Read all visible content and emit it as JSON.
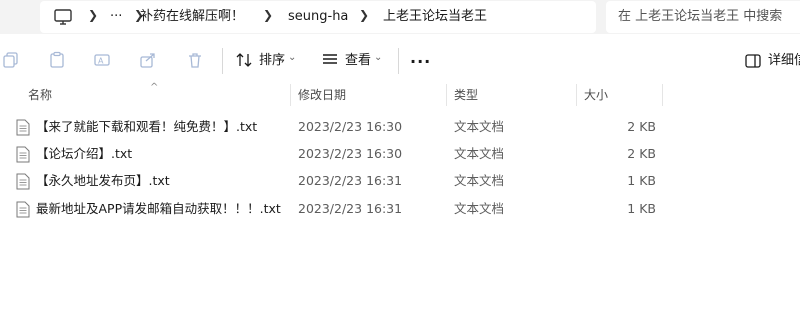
{
  "address": {
    "icon": "computer-icon",
    "breadcrumbs": [
      "补药在线解压啊！",
      "seung-ha",
      "上老王论坛当老王"
    ],
    "overflow": "···"
  },
  "search": {
    "placeholder": "在 上老王论坛当老王 中搜索"
  },
  "toolbar": {
    "sort_label": "排序",
    "view_label": "查看",
    "more_label": "···",
    "details_label": "详细信"
  },
  "columns": {
    "name": "名称",
    "date": "修改日期",
    "type": "类型",
    "size": "大小"
  },
  "files": [
    {
      "name": "【来了就能下载和观看！纯免费！】.txt",
      "date": "2023/2/23 16:30",
      "type": "文本文档",
      "size": "2 KB"
    },
    {
      "name": "【论坛介绍】.txt",
      "date": "2023/2/23 16:30",
      "type": "文本文档",
      "size": "2 KB"
    },
    {
      "name": "【永久地址发布页】.txt",
      "date": "2023/2/23 16:31",
      "type": "文本文档",
      "size": "1 KB"
    },
    {
      "name": "最新地址及APP请发邮箱自动获取！！！.txt",
      "date": "2023/2/23 16:31",
      "type": "文本文档",
      "size": "1 KB"
    }
  ]
}
